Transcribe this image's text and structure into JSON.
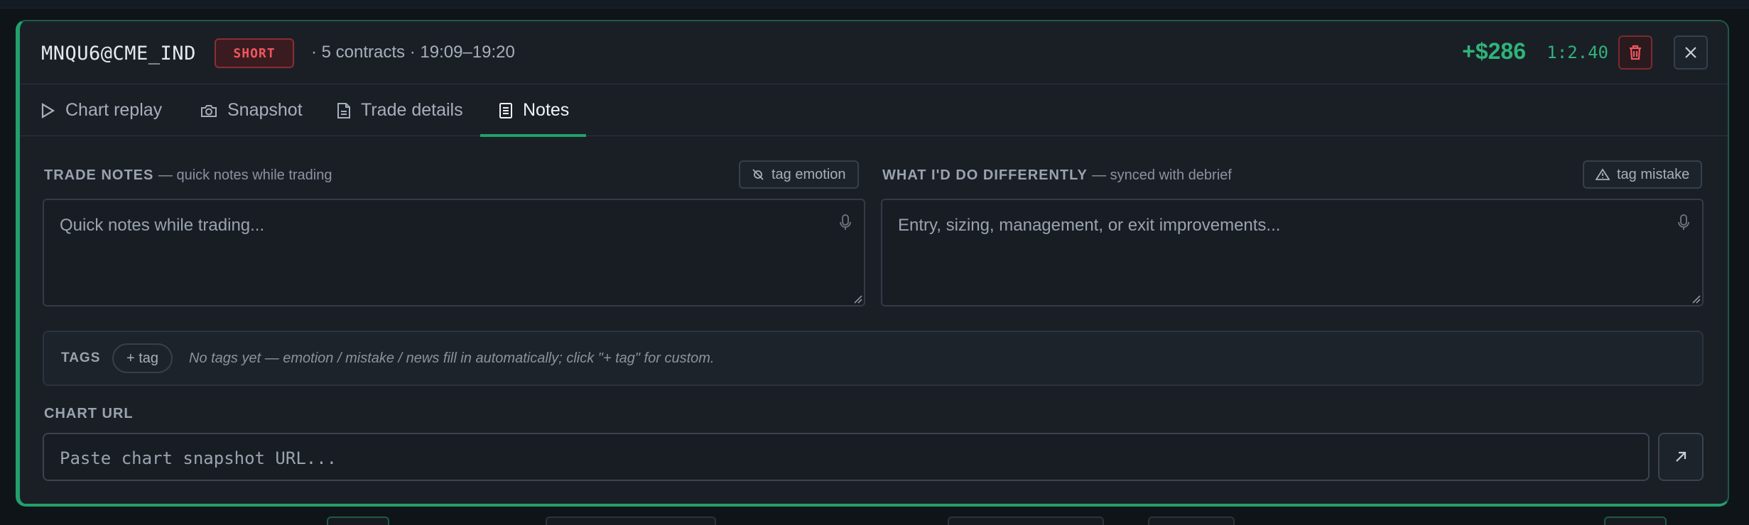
{
  "trade": {
    "symbol": "MNQU6@CME_IND",
    "side": "SHORT",
    "meta": "· 5 contracts · 19:09–19:20",
    "pnl": "+$286",
    "rr": "1:2.40"
  },
  "tabs": [
    {
      "label": "Chart replay",
      "icon": "play-icon"
    },
    {
      "label": "Snapshot",
      "icon": "camera-icon"
    },
    {
      "label": "Trade details",
      "icon": "document-icon"
    },
    {
      "label": "Notes",
      "icon": "notes-icon",
      "active": true
    }
  ],
  "notes": {
    "trade_notes": {
      "label": "TRADE NOTES",
      "sub": "— quick notes while trading",
      "tag_button": "tag emotion",
      "placeholder": "Quick notes while trading..."
    },
    "differently": {
      "label": "WHAT I'D DO DIFFERENTLY",
      "sub": "— synced with debrief",
      "tag_button": "tag mistake",
      "placeholder": "Entry, sizing, management, or exit improvements..."
    }
  },
  "tags": {
    "label": "TAGS",
    "add_label": "+ tag",
    "hint": "No tags yet — emotion / mistake / news fill in automatically; click \"+ tag\" for custom."
  },
  "chart_url": {
    "label": "CHART URL",
    "placeholder": "Paste chart snapshot URL..."
  },
  "colors": {
    "accent": "#22a06b",
    "profit": "#2fb37a",
    "short": "#f0565f",
    "panel_bg": "#1a1f26"
  }
}
